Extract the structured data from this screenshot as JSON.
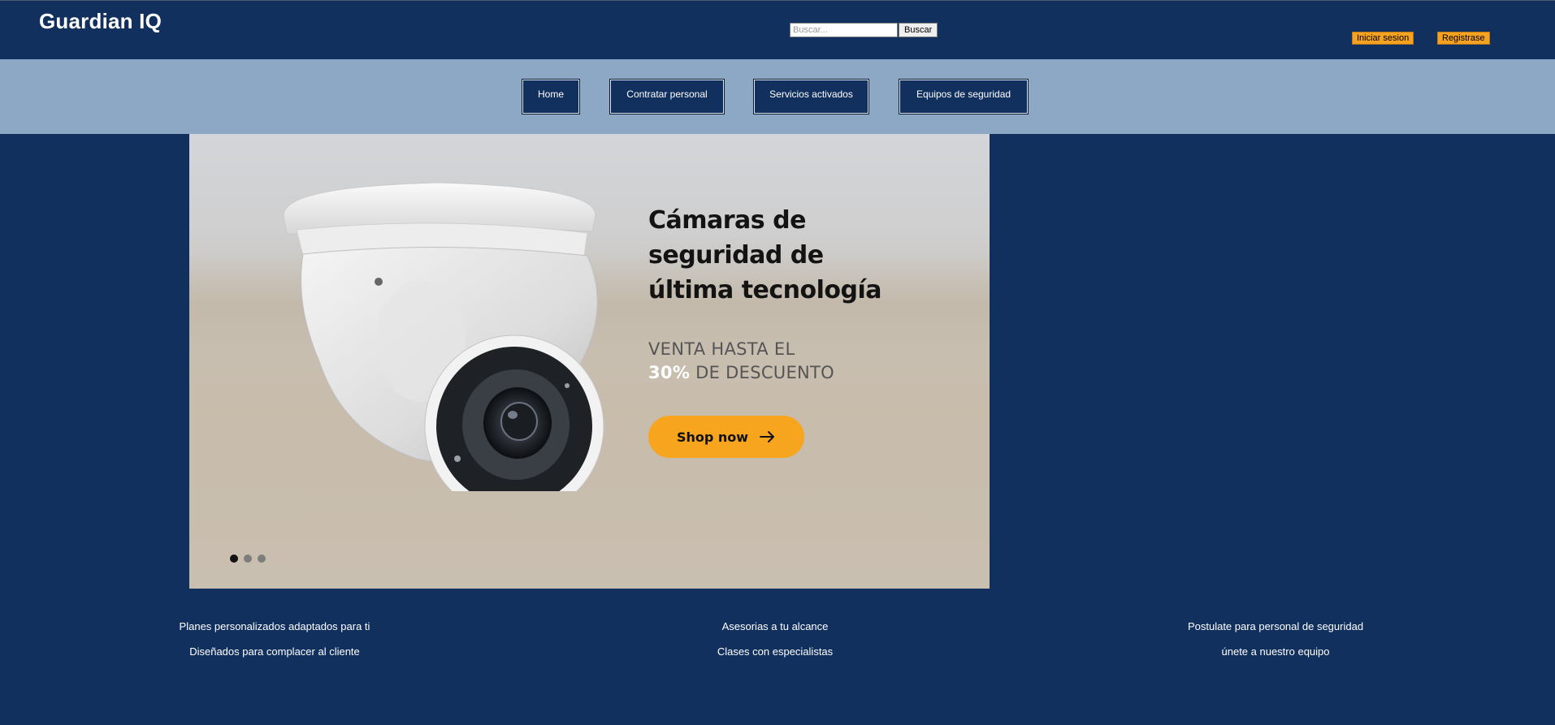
{
  "header": {
    "brand": "Guardian IQ",
    "search_placeholder": "Buscar...",
    "search_button": "Buscar",
    "login": "Iniciar sesion",
    "register": "Registrase"
  },
  "nav": {
    "items": [
      {
        "label": "Home"
      },
      {
        "label": "Contratar personal"
      },
      {
        "label": "Servicios activados"
      },
      {
        "label": "Equipos de seguridad"
      }
    ]
  },
  "hero": {
    "title_lines": [
      "Cámaras de",
      "seguridad de",
      "última tecnología"
    ],
    "sale_line1": "VENTA HASTA EL",
    "sale_percent": "30%",
    "sale_line2_rest": " DE DESCUENTO",
    "cta": "Shop now",
    "slides": 3,
    "active_slide": 1
  },
  "features": [
    {
      "line1": "Planes personalizados adaptados para ti",
      "line2": "Diseñados para complacer al cliente"
    },
    {
      "line1": "Asesorias a tu alcance",
      "line2": "Clases con especialistas"
    },
    {
      "line1": "Postulate para personal de seguridad",
      "line2": "únete a nuestro equipo"
    }
  ],
  "colors": {
    "background": "#12305e",
    "navbar": "#8da8c5",
    "accent": "#f4a21f"
  },
  "icons": {
    "cta_arrow": "arrow-right-icon",
    "hero_image": "security-camera-icon"
  }
}
